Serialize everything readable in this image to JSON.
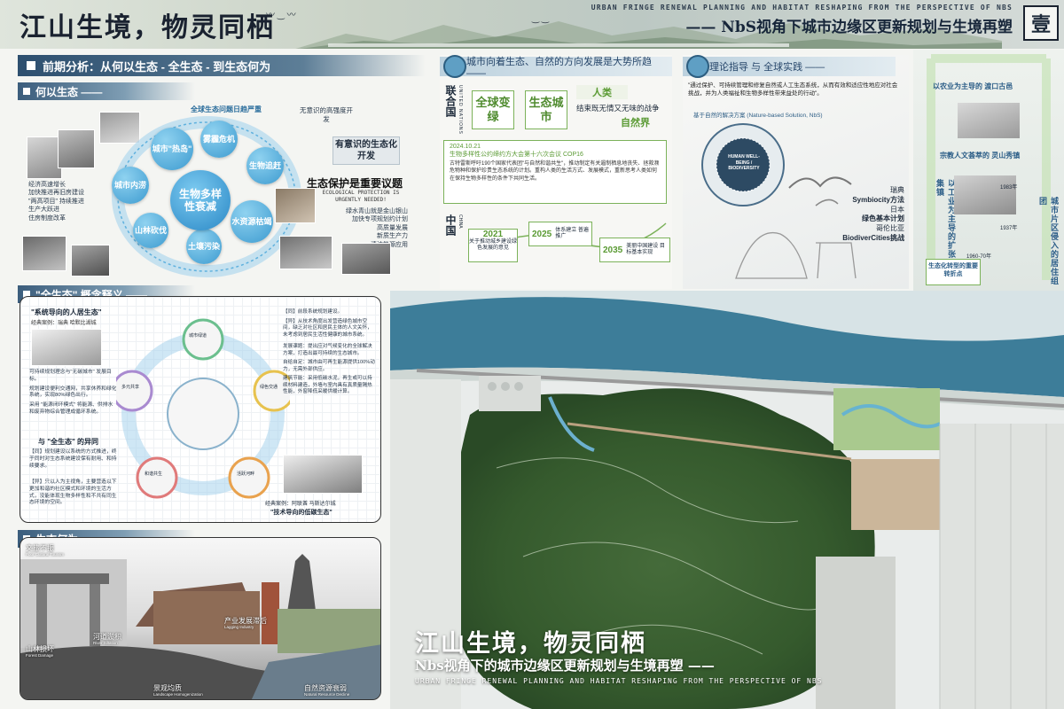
{
  "header": {
    "title": "江山生境，物灵同栖",
    "en_subtitle": "Urban fringe renewal planning and habitat reshaping from the perspective of NbS",
    "cn_subtitle": "—— NbS视角下城市边缘区更新规划与生境再塑",
    "sheet_number": "壹"
  },
  "section_analysis": {
    "title": "前期分析：从何以生态 - 全生态 - 到生态何为",
    "why_eco": {
      "heading": "何以生态 ——",
      "ring_label": "全球生态问题日趋严重",
      "center": "生物多样性衰减",
      "nodes": [
        "城市\"热岛\"",
        "雾霾危机",
        "生物追赶",
        "水资源枯竭",
        "土壤污染",
        "山林砍伐",
        "城市内涝"
      ],
      "left_notes": [
        "经济高速增长",
        "加快推进再旧房建设",
        "\"两高项目\" 持续推进",
        "生产大跃进",
        "住房制度改革"
      ],
      "right_top": "无意识的高强度开发",
      "right_mid": "有意识的生态化开发",
      "conclusion": "生态保护是重要议题",
      "conclusion_en": "Ecological protection is urgently needed!",
      "right_notes": [
        "绿水青山就是金山银山",
        "加快专项规划约计划",
        "高质量发展",
        "新质生产力",
        "清洁能源应用"
      ]
    },
    "full_eco": {
      "heading": "\"全生态\" 概念释义 ——",
      "caption_top": "\"系统导向的人居生态\"",
      "caption_top_sub": "经典案例：瑞典 哈默比湖城",
      "bullets_left": [
        "可持续规划理念与\"无碳城市\" 发展目标。",
        "规划建设便利交通网，共享休养和绿化系统，实现80%绿色出行。",
        "采用 \"能源闭环模式\" 将能源、供排水和废弃物综合管理成循环系统。"
      ],
      "compare_title": "与 \"全生态\" 的异同",
      "compare_same": "【同】规划建设以系统的方式推进，终于同时对生态系统建设保有耐用、和持续要求。",
      "compare_diff": "【异】只以人为主视角，主要营造以下更加和谐的社区模式和环境的生活方式，没能体现生物多样性和不共有同生态环境的空间。",
      "wheel_labels": [
        "城市绿道",
        "绿色交通",
        "活跃河畔",
        "和谐共生",
        "多元共享"
      ],
      "right_notes": [
        "【同】前段系统规划建设。",
        "【异】从技术角度出发营造绿色城市空间，缺乏对社区和居民主体的人文关怀，未考虑到居民生活性健康的城市系统。",
        "发展课题：提出应对气候变化的全球解决方案，打造出最可持续的生态城市。",
        "自给自足：城市由可再生能源提供100%动力，无需外部供应。",
        "建筑节能：采用低碳水泥，再生或可以持续材料建造，外墙与室内具有真质量隔热性能，外窗降低采暖供暖计算。"
      ],
      "caption_bottom": "经典案例：阿联酋 马斯达尔城",
      "caption_bottom_tag": "\"技术导向的低碳生态\""
    },
    "eco_action": {
      "heading": "生态何为 ——",
      "labels": [
        "文旅不振",
        "河道淤积",
        "山林损坏",
        "景观均质",
        "产业发展滞后",
        "自然资源衰弱"
      ],
      "labels_en": [
        "Poor Cultural Tourism",
        "River Siltation",
        "Forest Damage",
        "Landscape Homogenization",
        "Lagging Industry",
        "Natural Resource Decline"
      ]
    }
  },
  "top_right": {
    "trend_title": "城市向着生态、自然的方向发展是大势所趋 ——",
    "un_label": "联合国",
    "un_en": "UNITED NATIONS",
    "box_green": "全球变绿",
    "box_city": "生态城市",
    "phrases": [
      "人类",
      "结束既无情又无味的战争",
      "自然界"
    ],
    "cop_date": "2024.10.21",
    "cop_title": "生物多样性公约缔约方大会第十六次会议 COP16",
    "cop_text": "古特雷斯呼吁190个国家代表团\"与自然和谐共生\"，推动制定有关遏制栖息地丧失、拯救濒危物种和保护珍贵生态系统的计划。重构人类的生活方式、发展模式，重新思考人类如何在保持生物多样性的条件下共同生活。",
    "china_label": "中国",
    "china_en": "CHINA",
    "timeline": [
      {
        "year": "2021",
        "text": "关于推动城乡建设绿色发展的意见"
      },
      {
        "year": "2025",
        "text": "体系建立 普遍推广"
      },
      {
        "year": "2035",
        "text": "美丽中国建设 目标基本实现"
      }
    ],
    "theory_title": "理论指导 与 全球实践 ——",
    "quote": "\"通过保护、可持续管理和修复自然或人工生态系统，从而有效和适应性地应对社会挑战，并为人类福祉和生物多样性带来益处的行动\"。",
    "nbs_label": "基于自然的解决方案 (Nature-based Solution, NbS)",
    "badge_text": "HUMAN WELL-BEING / BIODIVERSITY",
    "practice": [
      {
        "country": "瑞典",
        "name": "Symbiocity方法"
      },
      {
        "country": "日本",
        "name": "绿色基本计划"
      },
      {
        "country": "哥伦比亚",
        "name": "BiodiverCities挑战"
      }
    ]
  },
  "side_strip": {
    "top": "以农业为主导的 渡口古邑",
    "mid": "宗教人文荟萃的 灵山秀镇",
    "v1": "以工业为主导的扩张集镇",
    "v2": "城市片区侵入的居住组团",
    "years": [
      "1937年",
      "1960-70年",
      "1983年"
    ],
    "bottom": "生态化转型的重要转折点"
  },
  "map": {
    "title": "江山生境，物灵同栖",
    "subtitle": "Nbs视角下的城市边缘区更新规划与生境再塑 ——",
    "en": "Urban fringe renewal planning and habitat reshaping from the perspective of NbS"
  }
}
